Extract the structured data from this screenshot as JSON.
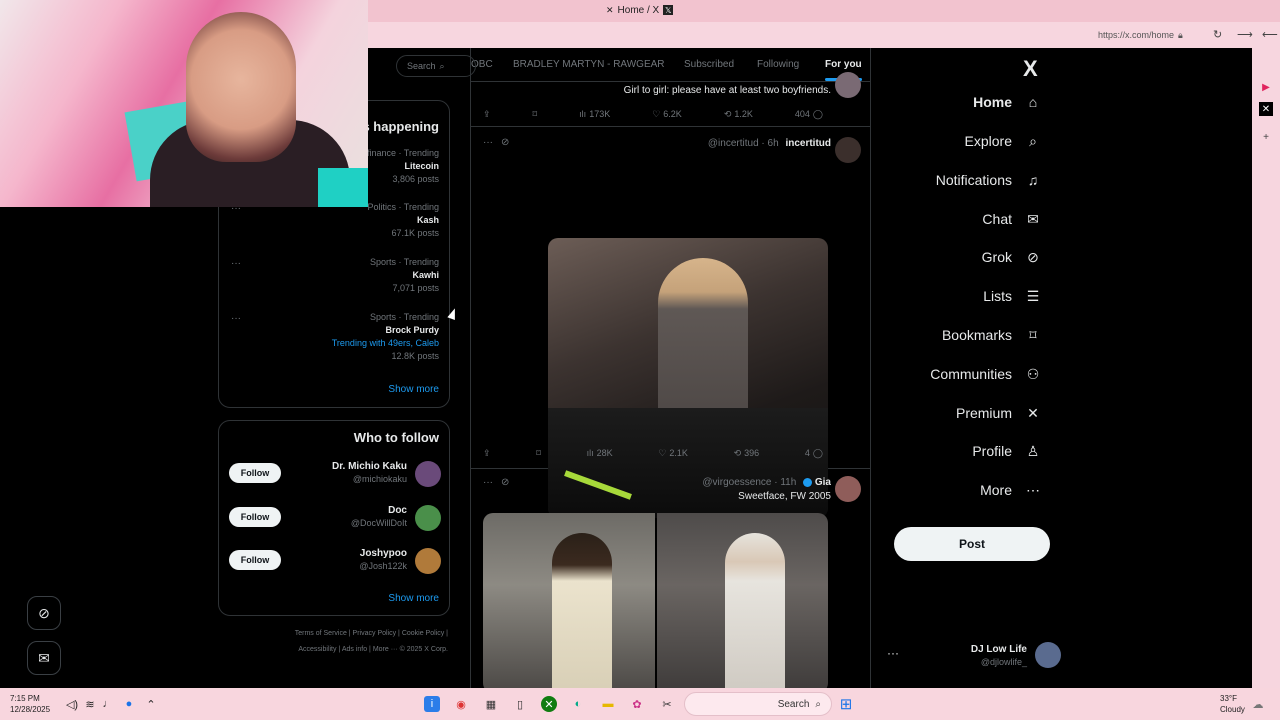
{
  "browser": {
    "tab_title": "Home / X",
    "url": "https://x.com/home"
  },
  "nav": {
    "logo": "X",
    "items": [
      {
        "label": "Home",
        "icon": "home-icon",
        "glyph": "⌂"
      },
      {
        "label": "Explore",
        "icon": "search-icon",
        "glyph": "⌕"
      },
      {
        "label": "Notifications",
        "icon": "bell-icon",
        "glyph": "♫"
      },
      {
        "label": "Chat",
        "icon": "mail-icon",
        "glyph": "✉"
      },
      {
        "label": "Grok",
        "icon": "grok-icon",
        "glyph": "⊘"
      },
      {
        "label": "Lists",
        "icon": "list-icon",
        "glyph": "☰"
      },
      {
        "label": "Bookmarks",
        "icon": "bookmark-icon",
        "glyph": "⌑"
      },
      {
        "label": "Communities",
        "icon": "communities-icon",
        "glyph": "⚇"
      },
      {
        "label": "Premium",
        "icon": "x-premium-icon",
        "glyph": "✕"
      },
      {
        "label": "Profile",
        "icon": "profile-icon",
        "glyph": "♙"
      },
      {
        "label": "More",
        "icon": "more-circle-icon",
        "glyph": "⋯"
      }
    ],
    "post_label": "Post",
    "account": {
      "name": "DJ Low Life",
      "handle": "@djlowlife_"
    }
  },
  "timeline": {
    "tabs": [
      "For you",
      "Following",
      "Subscribed",
      "BRADLEY MARTYN - RAWGEAR",
      "OBC"
    ],
    "tweet0": {
      "text": "Girl to girl: please have at least two boyfriends.",
      "replies": "404",
      "reposts": "1.2K",
      "likes": "6.2K",
      "views": "173K"
    },
    "tweet1": {
      "name": "incertitud",
      "handle": "@incertitud",
      "time": "6h",
      "replies": "4",
      "reposts": "396",
      "likes": "2.1K",
      "views": "28K"
    },
    "tweet2": {
      "name": "Gia",
      "handle": "@virgoessence",
      "time": "11h",
      "text": "Sweetface, FW 2005"
    }
  },
  "sidebar": {
    "search_placeholder": "Search",
    "whats_happening": "What's happening",
    "trends": [
      {
        "category": "Business and finance · Trending",
        "title": "Litecoin",
        "count": "3,806 posts",
        "with": ""
      },
      {
        "category": "Politics · Trending",
        "title": "Kash",
        "count": "67.1K posts",
        "with": ""
      },
      {
        "category": "Sports · Trending",
        "title": "Kawhi",
        "count": "7,071 posts",
        "with": ""
      },
      {
        "category": "Sports · Trending",
        "title": "Brock Purdy",
        "count": "12.8K posts",
        "with": "Trending with 49ers, Caleb"
      }
    ],
    "show_more": "Show more",
    "who_to_follow": "Who to follow",
    "follow_suggestions": [
      {
        "name": "Dr. Michio Kaku",
        "handle": "@michiokaku",
        "follow": "Follow"
      },
      {
        "name": "Doc",
        "handle": "@DocWillDoIt",
        "follow": "Follow"
      },
      {
        "name": "Joshypoo",
        "handle": "@Josh122k",
        "follow": "Follow"
      }
    ],
    "footer": {
      "line1": "Terms of Service | Privacy Policy | Cookie Policy |",
      "line2": "Accessibility | Ads info | More ··· © 2025 X Corp."
    }
  },
  "taskbar": {
    "search_label": "Search",
    "time": "7:15 PM",
    "date": "12/28/2025",
    "weather_temp": "33°F",
    "weather_text": "Cloudy"
  },
  "colors": {
    "accent": "#1d9bf0",
    "background": "#000000",
    "border": "#2f3336",
    "muted": "#71767b"
  }
}
